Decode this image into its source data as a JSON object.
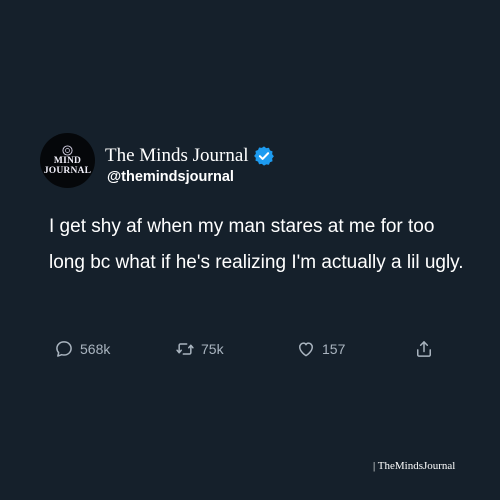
{
  "account": {
    "avatar_line1": "MIND",
    "avatar_line2": "JOURNAL",
    "display_name": "The Minds Journal",
    "handle": "@themindsjournal",
    "verified_icon": "verified-badge-icon",
    "verified_color": "#1d9bf0"
  },
  "tweet": {
    "text": "I get shy af when my man stares at me for too long bc what if he's realizing I'm actually a lil ugly."
  },
  "actions": {
    "reply_count": "568k",
    "retweet_count": "75k",
    "like_count": "157",
    "reply_icon": "comment-icon",
    "retweet_icon": "retweet-icon",
    "like_icon": "heart-icon",
    "share_icon": "share-icon"
  },
  "watermark": {
    "text": "| TheMindsJournal"
  },
  "colors": {
    "background": "#15202b",
    "text": "#ffffff",
    "action_gray": "#a9b4bf"
  }
}
